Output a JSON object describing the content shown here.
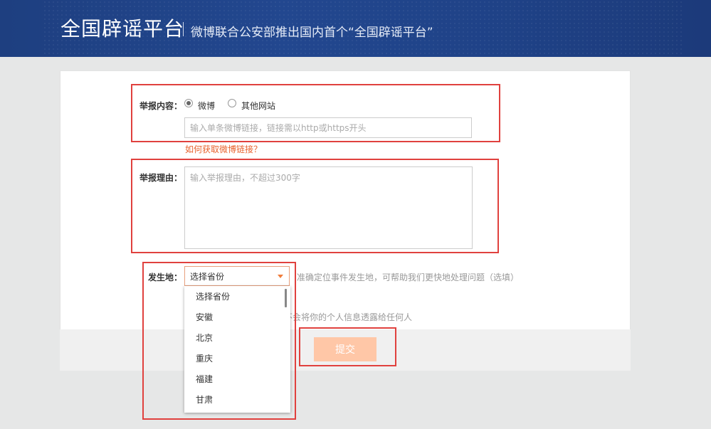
{
  "header": {
    "title": "全国辟谣平台",
    "subtitle": "微博联合公安部推出国内首个“全国辟谣平台”"
  },
  "form": {
    "report_content": {
      "label": "举报内容：",
      "options": [
        "微博",
        "其他网站"
      ],
      "selected": "微博",
      "url_placeholder": "输入单条微博链接，链接需以http或https开头",
      "help_link": "如何获取微博链接？"
    },
    "report_reason": {
      "label": "举报理由：",
      "placeholder": "输入举报理由，不超过300字"
    },
    "location": {
      "label": "发生地：",
      "selected": "选择省份",
      "hint": "准确定位事件发生地，可帮助我们更快地处理问题（选填）",
      "options": [
        "选择省份",
        "安徽",
        "北京",
        "重庆",
        "福建",
        "甘肃"
      ]
    },
    "privacy_note": "我们不会将你的个人信息透露给任何人",
    "submit_label": "提交"
  },
  "colors": {
    "header_bg": "#1f4287",
    "accent": "#e8612d",
    "submit_bg": "#ffc7a7",
    "highlight": "#e0413e"
  }
}
